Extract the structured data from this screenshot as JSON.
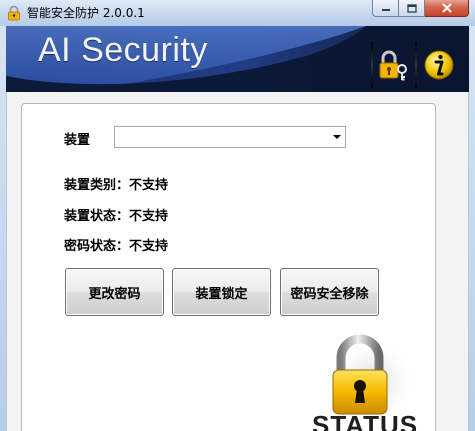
{
  "window": {
    "title": "智能安全防护 2.0.0.1"
  },
  "banner": {
    "title": "AI Security"
  },
  "device": {
    "label": "装置",
    "selected_value": "",
    "options": []
  },
  "info": {
    "category": "装置类别：不支持",
    "state": "装置状态：不支持",
    "password_state": "密码状态：不支持"
  },
  "buttons": {
    "change_password": "更改密码",
    "device_lock": "装置锁定",
    "remove_password": "密码安全移除"
  },
  "status": {
    "text": "STATUS"
  },
  "colors": {
    "banner_dark": "#0a1530",
    "banner_blue": "#2a4fa6",
    "panel_border": "#b8b8b8",
    "lock_gold": "#f5b800",
    "close_red": "#c2442a"
  },
  "icons": {
    "app": "padlock-icon",
    "lock_button": "padlock-key-icon",
    "info_button": "info-icon",
    "status": "padlock-icon"
  }
}
